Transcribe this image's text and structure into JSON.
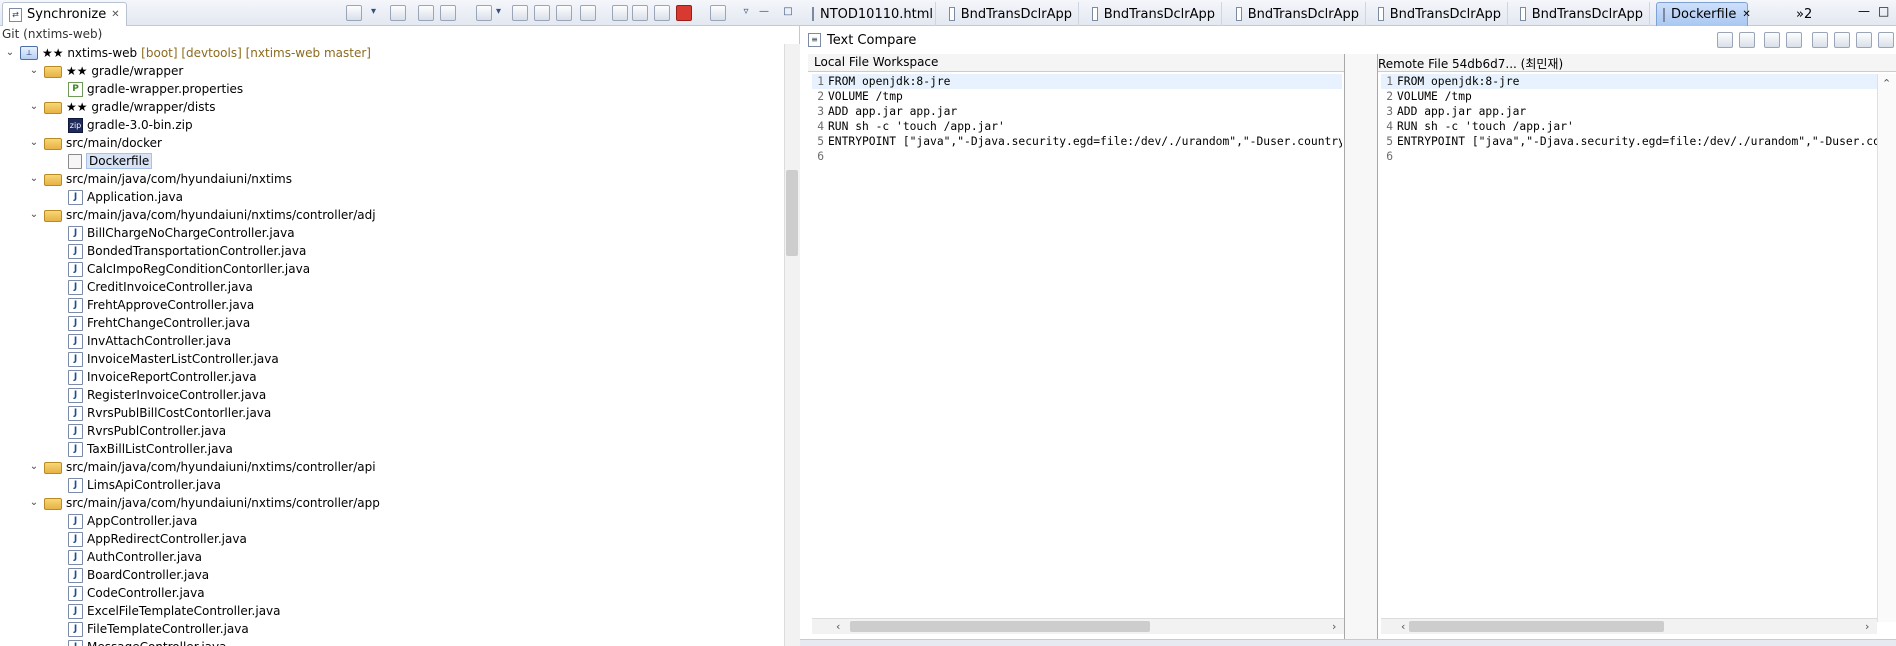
{
  "left": {
    "view_tab_label": "Synchronize",
    "close_glyph": "✕",
    "git_label": "Git (nxtims-web)",
    "toolbar_icons": [
      "sync-icon",
      "dropdown-icon",
      "open-icon",
      "incoming-icon",
      "outgoing-icon",
      "tree-mode-icon",
      "dropdown-icon",
      "expand-all-icon",
      "collapse-all-icon",
      "next-icon",
      "prev-icon",
      "pin-icon",
      "link-icon",
      "compare-icon",
      "stop-icon",
      "back-icon",
      "menu-icon",
      "minimize-icon",
      "maximize-icon"
    ],
    "tree": [
      {
        "indent": 0,
        "chev": "⌄",
        "icon": "project",
        "stars": "",
        "label": "★★ nxtims-web",
        "deco": "[boot] [devtools] [nxtims-web master]"
      },
      {
        "indent": 1,
        "chev": "⌄",
        "icon": "folder",
        "stars": "",
        "label": "★★ gradle/wrapper",
        "deco": ""
      },
      {
        "indent": 2,
        "chev": "",
        "icon": "props",
        "stars": "",
        "label": "gradle-wrapper.properties",
        "deco": ""
      },
      {
        "indent": 1,
        "chev": "⌄",
        "icon": "folder",
        "stars": "",
        "label": "★★ gradle/wrapper/dists",
        "deco": ""
      },
      {
        "indent": 2,
        "chev": "",
        "icon": "zip",
        "stars": "",
        "label": "gradle-3.0-bin.zip",
        "deco": ""
      },
      {
        "indent": 1,
        "chev": "⌄",
        "icon": "folder",
        "stars": "",
        "label": "src/main/docker",
        "deco": ""
      },
      {
        "indent": 2,
        "chev": "",
        "icon": "file",
        "stars": "",
        "label": "Dockerfile",
        "deco": "",
        "selected": true
      },
      {
        "indent": 1,
        "chev": "⌄",
        "icon": "folder",
        "stars": "",
        "label": "src/main/java/com/hyundaiuni/nxtims",
        "deco": ""
      },
      {
        "indent": 2,
        "chev": "",
        "icon": "java",
        "stars": "",
        "label": "Application.java",
        "deco": ""
      },
      {
        "indent": 1,
        "chev": "⌄",
        "icon": "folder",
        "stars": "",
        "label": "src/main/java/com/hyundaiuni/nxtims/controller/adj",
        "deco": ""
      },
      {
        "indent": 2,
        "chev": "",
        "icon": "java",
        "stars": "",
        "label": "BillChargeNoChargeController.java",
        "deco": ""
      },
      {
        "indent": 2,
        "chev": "",
        "icon": "java",
        "stars": "",
        "label": "BondedTransportationController.java",
        "deco": ""
      },
      {
        "indent": 2,
        "chev": "",
        "icon": "java",
        "stars": "",
        "label": "CalcImpoRegConditionContorller.java",
        "deco": ""
      },
      {
        "indent": 2,
        "chev": "",
        "icon": "java",
        "stars": "",
        "label": "CreditInvoiceController.java",
        "deco": ""
      },
      {
        "indent": 2,
        "chev": "",
        "icon": "java",
        "stars": "",
        "label": "FrehtApproveController.java",
        "deco": ""
      },
      {
        "indent": 2,
        "chev": "",
        "icon": "java",
        "stars": "",
        "label": "FrehtChangeController.java",
        "deco": ""
      },
      {
        "indent": 2,
        "chev": "",
        "icon": "java",
        "stars": "",
        "label": "InvAttachController.java",
        "deco": ""
      },
      {
        "indent": 2,
        "chev": "",
        "icon": "java",
        "stars": "",
        "label": "InvoiceMasterListController.java",
        "deco": ""
      },
      {
        "indent": 2,
        "chev": "",
        "icon": "java",
        "stars": "",
        "label": "InvoiceReportController.java",
        "deco": ""
      },
      {
        "indent": 2,
        "chev": "",
        "icon": "java",
        "stars": "",
        "label": "RegisterInvoiceController.java",
        "deco": ""
      },
      {
        "indent": 2,
        "chev": "",
        "icon": "java",
        "stars": "",
        "label": "RvrsPublBillCostContorller.java",
        "deco": ""
      },
      {
        "indent": 2,
        "chev": "",
        "icon": "java",
        "stars": "",
        "label": "RvrsPublController.java",
        "deco": ""
      },
      {
        "indent": 2,
        "chev": "",
        "icon": "java",
        "stars": "",
        "label": "TaxBillListController.java",
        "deco": ""
      },
      {
        "indent": 1,
        "chev": "⌄",
        "icon": "folder",
        "stars": "",
        "label": "src/main/java/com/hyundaiuni/nxtims/controller/api",
        "deco": ""
      },
      {
        "indent": 2,
        "chev": "",
        "icon": "java",
        "stars": "",
        "label": "LimsApiController.java",
        "deco": ""
      },
      {
        "indent": 1,
        "chev": "⌄",
        "icon": "folder",
        "stars": "",
        "label": "src/main/java/com/hyundaiuni/nxtims/controller/app",
        "deco": ""
      },
      {
        "indent": 2,
        "chev": "",
        "icon": "java",
        "stars": "",
        "label": "AppController.java",
        "deco": ""
      },
      {
        "indent": 2,
        "chev": "",
        "icon": "java",
        "stars": "",
        "label": "AppRedirectController.java",
        "deco": ""
      },
      {
        "indent": 2,
        "chev": "",
        "icon": "java",
        "stars": "",
        "label": "AuthController.java",
        "deco": ""
      },
      {
        "indent": 2,
        "chev": "",
        "icon": "java",
        "stars": "",
        "label": "BoardController.java",
        "deco": ""
      },
      {
        "indent": 2,
        "chev": "",
        "icon": "java",
        "stars": "",
        "label": "CodeController.java",
        "deco": ""
      },
      {
        "indent": 2,
        "chev": "",
        "icon": "java",
        "stars": "",
        "label": "ExcelFileTemplateController.java",
        "deco": ""
      },
      {
        "indent": 2,
        "chev": "",
        "icon": "java",
        "stars": "",
        "label": "FileTemplateController.java",
        "deco": ""
      },
      {
        "indent": 2,
        "chev": "",
        "icon": "java",
        "stars": "",
        "label": "MessageController.java",
        "deco": ""
      }
    ]
  },
  "editor": {
    "tabs": [
      {
        "label": "NTOD10110.html",
        "icon": "html-file-icon",
        "active": false
      },
      {
        "label": "BndTransDclrApp",
        "icon": "x-file-icon",
        "active": false
      },
      {
        "label": "BndTransDclrApp",
        "icon": "java-file-icon",
        "active": false
      },
      {
        "label": "BndTransDclrApp",
        "icon": "java-file-icon",
        "active": false
      },
      {
        "label": "BndTransDclrApp",
        "icon": "java-file-icon",
        "active": false
      },
      {
        "label": "BndTransDclrApp",
        "icon": "java-file-icon",
        "active": false
      },
      {
        "label": "Dockerfile",
        "icon": "compare-file-icon",
        "active": true
      }
    ],
    "overflow_label": "»2",
    "compare_title": "Text Compare",
    "local_title": "Local File Workspace",
    "remote_title": "Remote File 54db6d7... (최민재)",
    "local_lines": [
      "FROM openjdk:8-jre",
      "VOLUME /tmp",
      "ADD app.jar app.jar",
      "RUN sh -c 'touch /app.jar'",
      "ENTRYPOINT [\"java\",\"-Djava.security.egd=file:/dev/./urandom\",\"-Duser.country=",
      ""
    ],
    "remote_lines": [
      "FROM openjdk:8-jre",
      "VOLUME /tmp",
      "ADD app.jar app.jar",
      "RUN sh -c 'touch /app.jar'",
      "ENTRYPOINT [\"java\",\"-Djava.security.egd=file:/dev/./urandom\",\"-Duser.coun",
      ""
    ]
  }
}
